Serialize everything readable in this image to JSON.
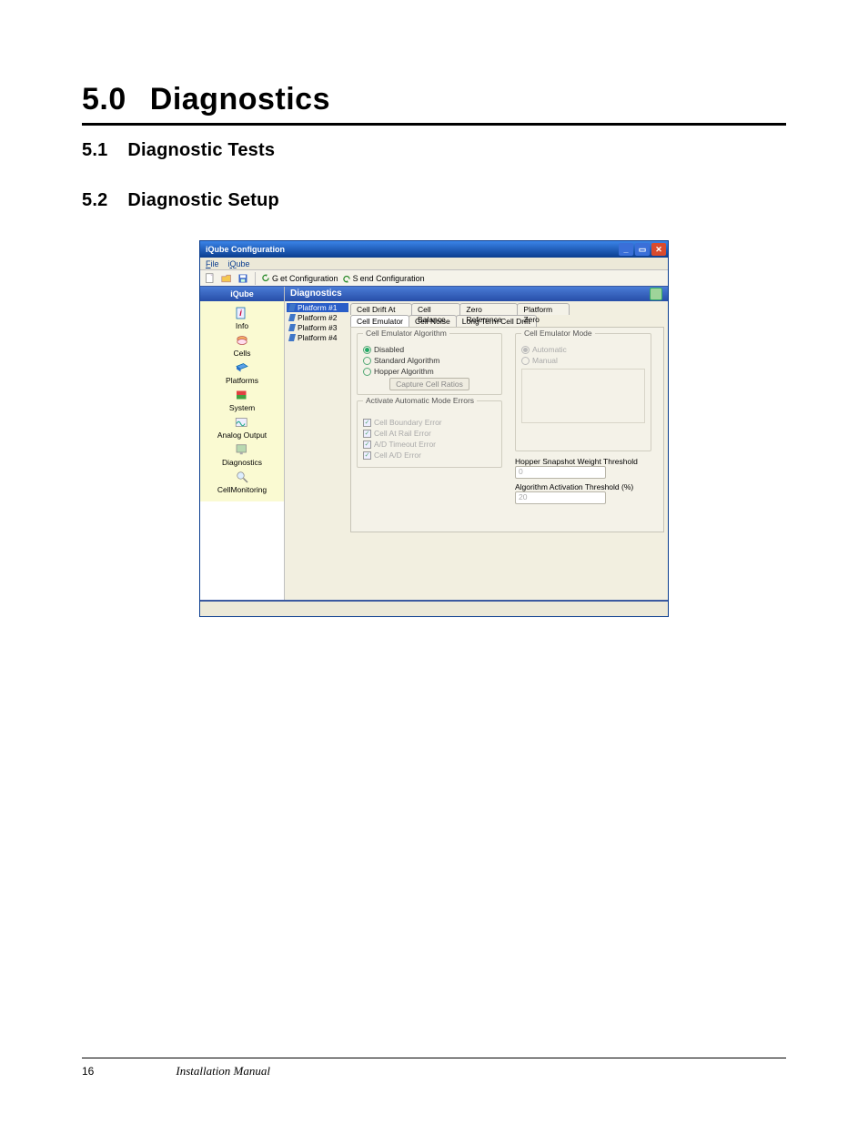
{
  "doc": {
    "h1_num": "5.0",
    "h1_title": "Diagnostics",
    "h2a_num": "5.1",
    "h2a_title": "Diagnostic Tests",
    "h2b_num": "5.2",
    "h2b_title": "Diagnostic Setup",
    "page_number": "16",
    "manual_title": "Installation Manual"
  },
  "win": {
    "title": "iQube Configuration",
    "menu": {
      "file": "File",
      "iqube": "iQube"
    },
    "toolbar": {
      "get": "Get Configuration",
      "send": "Send Configuration"
    },
    "nav": {
      "header": "iQube",
      "items": [
        "Info",
        "Cells",
        "Platforms",
        "System",
        "Analog Output",
        "Diagnostics",
        "CellMonitoring"
      ]
    },
    "pane": {
      "title": "Diagnostics"
    },
    "tree": {
      "items": [
        "Platform #1",
        "Platform #2",
        "Platform #3",
        "Platform #4"
      ],
      "selected": 0
    },
    "tabs_row2": [
      "Cell Drift At Load",
      "Cell Balance",
      "Zero Reference",
      "Platform Zero"
    ],
    "tabs_row1": [
      "Cell Emulator",
      "Cell Noise",
      "Long Term Cell Drift"
    ],
    "groups": {
      "algo": {
        "legend": "Cell Emulator Algorithm",
        "radios": [
          "Disabled",
          "Standard Algorithm",
          "Hopper Algorithm"
        ],
        "selected": 0,
        "button": "Capture Cell Ratios"
      },
      "errors": {
        "legend": "Activate Automatic Mode Errors",
        "checks": [
          "Cell Boundary Error",
          "Cell At Rail Error",
          "A/D Timeout Error",
          "Cell A/D Error"
        ]
      },
      "mode": {
        "legend": "Cell Emulator Mode",
        "radios": [
          "Automatic",
          "Manual"
        ],
        "selected": 0
      },
      "hopper_label": "Hopper Snapshot Weight Threshold",
      "hopper_value": "0",
      "algo_thresh_label": "Algorithm Activation Threshold (%)",
      "algo_thresh_value": "20"
    }
  }
}
